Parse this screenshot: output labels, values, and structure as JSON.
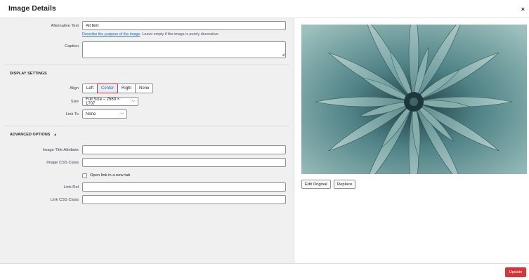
{
  "header": {
    "title": "Image Details",
    "close_icon": "close-icon",
    "close_glyph": "×"
  },
  "alt": {
    "label": "Alternative Text",
    "value": "Alt text",
    "hint_link": "Describe the purpose of the image",
    "hint_rest": ". Leave empty if the image is purely decorative."
  },
  "caption": {
    "label": "Caption",
    "value": "",
    "resize_glyph": "◢"
  },
  "display_settings": {
    "heading": "DISPLAY SETTINGS",
    "align_label": "Align",
    "align_options": [
      "Left",
      "Center",
      "Right",
      "None"
    ],
    "align_selected": "Center",
    "size_label": "Size",
    "size_value": "Full Size – 2560 × 1707",
    "link_to_label": "Link To",
    "link_to_value": "None",
    "chevron_glyph": "⌵"
  },
  "advanced": {
    "heading": "ADVANCED OPTIONS",
    "toggle_glyph": "▲",
    "title_attr_label": "Image Title Attribute",
    "title_attr_value": "",
    "css_class_label": "Image CSS Class",
    "css_class_value": "",
    "new_tab_label": "Open link in a new tab",
    "new_tab_checked": false,
    "link_rel_label": "Link Rel",
    "link_rel_value": "",
    "link_css_label": "Link CSS Class",
    "link_css_value": ""
  },
  "image_actions": {
    "edit_label": "Edit Original",
    "replace_label": "Replace"
  },
  "footer": {
    "update_label": "Update"
  },
  "colors": {
    "accent": "#d63638",
    "link": "#2271b1",
    "panel_bg": "#f0f0f1"
  }
}
